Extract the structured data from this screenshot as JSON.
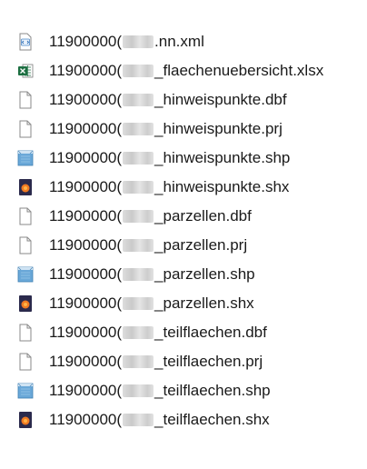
{
  "files": [
    {
      "prefix": "11900000(",
      "suffix": ".nn.xml",
      "icon": "xml-file-icon"
    },
    {
      "prefix": "11900000(",
      "suffix": "_flaechenuebersicht.xlsx",
      "icon": "excel-file-icon"
    },
    {
      "prefix": "11900000(",
      "suffix": "_hinweispunkte.dbf",
      "icon": "blank-file-icon"
    },
    {
      "prefix": "11900000(",
      "suffix": "_hinweispunkte.prj",
      "icon": "blank-file-icon"
    },
    {
      "prefix": "11900000(",
      "suffix": "_hinweispunkte.shp",
      "icon": "shp-file-icon"
    },
    {
      "prefix": "11900000(",
      "suffix": "_hinweispunkte.shx",
      "icon": "shx-file-icon"
    },
    {
      "prefix": "11900000(",
      "suffix": "_parzellen.dbf",
      "icon": "blank-file-icon"
    },
    {
      "prefix": "11900000(",
      "suffix": "_parzellen.prj",
      "icon": "blank-file-icon"
    },
    {
      "prefix": "11900000(",
      "suffix": "_parzellen.shp",
      "icon": "shp-file-icon"
    },
    {
      "prefix": "11900000(",
      "suffix": "_parzellen.shx",
      "icon": "shx-file-icon"
    },
    {
      "prefix": "11900000(",
      "suffix": "_teilflaechen.dbf",
      "icon": "blank-file-icon"
    },
    {
      "prefix": "11900000(",
      "suffix": "_teilflaechen.prj",
      "icon": "blank-file-icon"
    },
    {
      "prefix": "11900000(",
      "suffix": "_teilflaechen.shp",
      "icon": "shp-file-icon"
    },
    {
      "prefix": "11900000(",
      "suffix": "_teilflaechen.shx",
      "icon": "shx-file-icon"
    }
  ],
  "colors": {
    "excel_green": "#1d6f42",
    "shx_dark": "#2b2a4c",
    "shx_orange": "#f07a22",
    "shp_blue": "#6aa8d8"
  }
}
